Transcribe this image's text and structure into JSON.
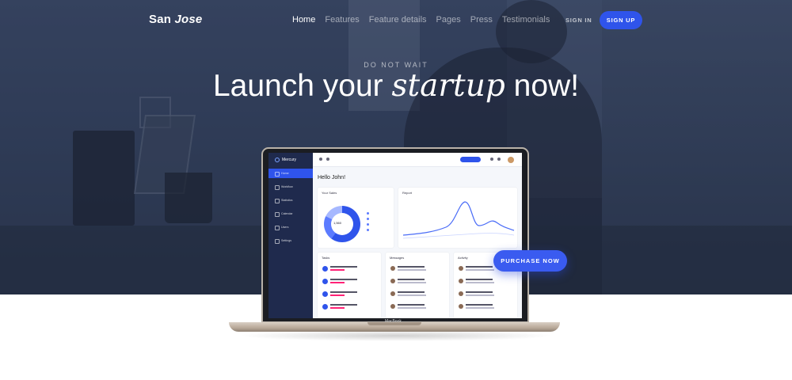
{
  "brand": {
    "name_plain": "San ",
    "name_italic": "Jose"
  },
  "nav": {
    "items": [
      "Home",
      "Features",
      "Feature details",
      "Pages",
      "Press",
      "Testimonials"
    ],
    "active_index": 0
  },
  "auth": {
    "sign_in": "SIGN IN",
    "sign_up": "SIGN UP"
  },
  "hero": {
    "kicker": "DO NOT WAIT",
    "headline_before": "Launch your ",
    "headline_italic": "startup",
    "headline_after": " now!"
  },
  "cta": {
    "purchase": "PURCHASE NOW"
  },
  "laptop": {
    "label": "MacBook",
    "dashboard": {
      "app_name": "Mercury",
      "menu": [
        "Home",
        "Workflow",
        "Statistics",
        "Calendar",
        "Users",
        "Settings"
      ],
      "greeting": "Hello John!",
      "cards": {
        "sales": "Your Sales",
        "report": "Report",
        "tasks": "Tasks",
        "messages": "Messages",
        "activity": "Activity"
      },
      "donut_value": "1,560"
    }
  },
  "colors": {
    "accent": "#2f54eb",
    "hero_bg": "#3c4a66",
    "sidebar": "#1f2a4d"
  }
}
